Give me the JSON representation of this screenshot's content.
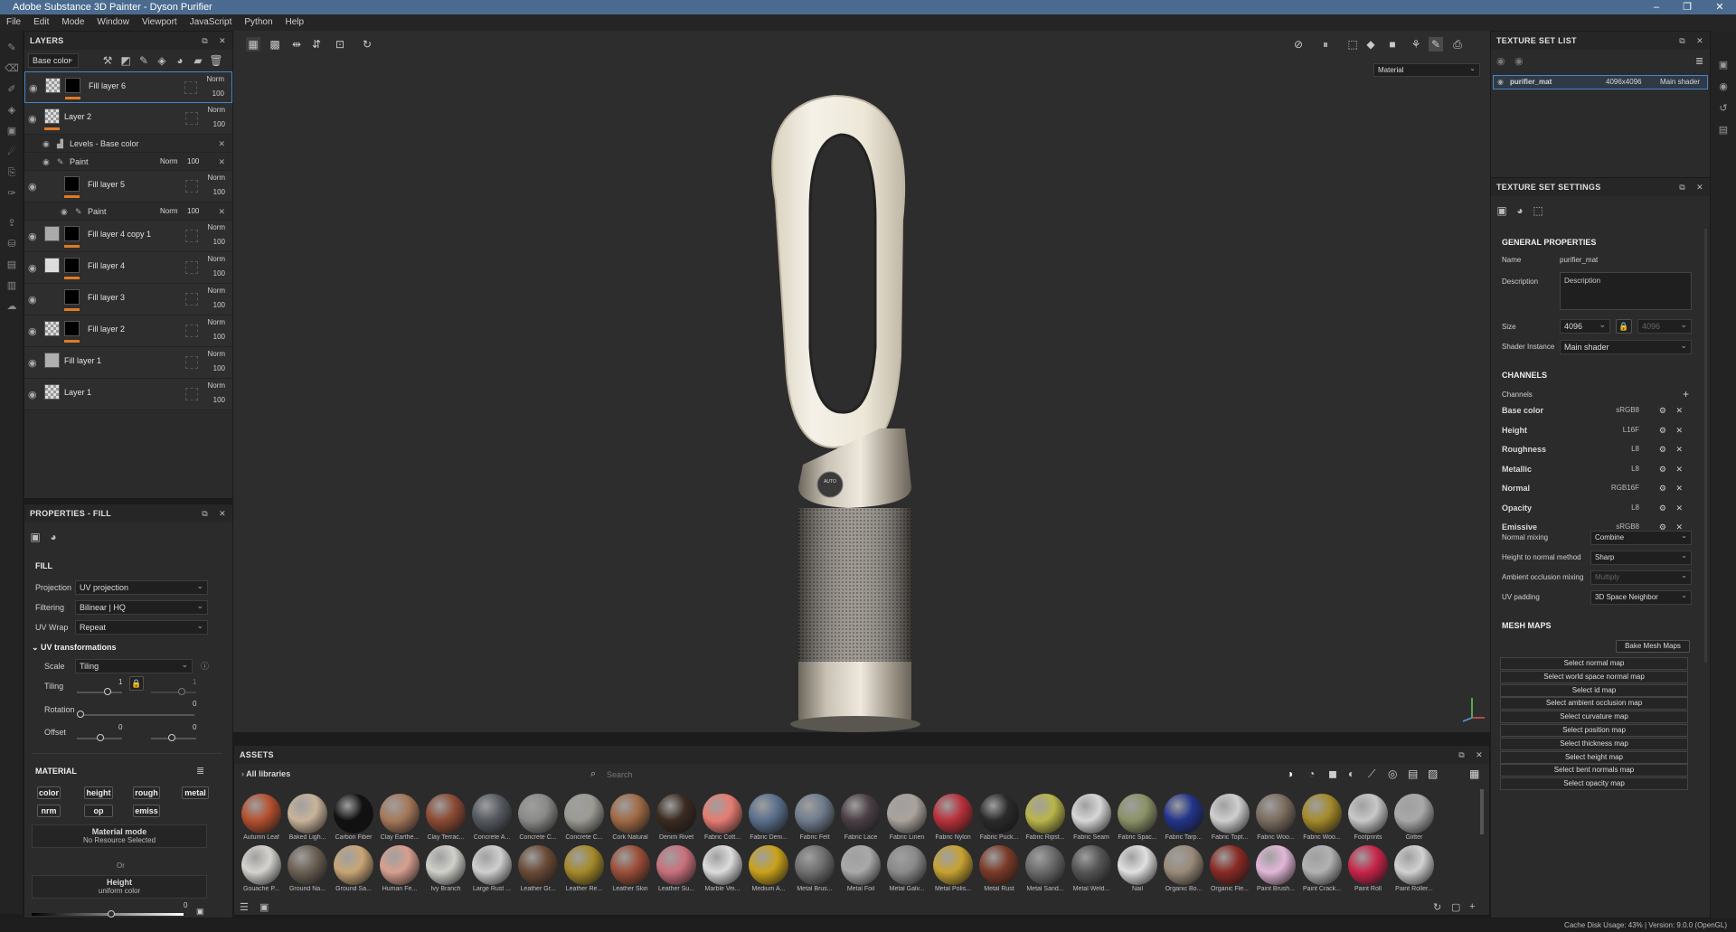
{
  "app": {
    "title": "Adobe Substance 3D Painter - Dyson Purifier"
  },
  "menu": [
    "File",
    "Edit",
    "Mode",
    "Window",
    "Viewport",
    "JavaScript",
    "Python",
    "Help"
  ],
  "layers": {
    "title": "LAYERS",
    "channel_select": "Base color",
    "items": [
      {
        "name": "Fill layer 6",
        "blend": "Norm",
        "opacity": "100",
        "thumb": "checker",
        "mask": "blk"
      },
      {
        "name": "Layer 2",
        "blend": "Norm",
        "opacity": "100",
        "thumb": "checker"
      },
      {
        "name": "Fill layer 5",
        "blend": "Norm",
        "opacity": "100",
        "thumb": "blk",
        "mask": "blk"
      },
      {
        "name": "Fill layer 4 copy 1",
        "blend": "Norm",
        "opacity": "100",
        "thumb": "gray",
        "mask": "blk"
      },
      {
        "name": "Fill layer 4",
        "blend": "Norm",
        "opacity": "100",
        "thumb": "gray",
        "mask": "blk"
      },
      {
        "name": "Fill layer 3",
        "blend": "Norm",
        "opacity": "100",
        "thumb": "blk",
        "mask": "blk"
      },
      {
        "name": "Fill layer 2",
        "blend": "Norm",
        "opacity": "100",
        "thumb": "checker",
        "mask": "blk"
      },
      {
        "name": "Fill layer 1",
        "blend": "Norm",
        "opacity": "100",
        "thumb": "gray"
      },
      {
        "name": "Layer 1",
        "blend": "Norm",
        "opacity": "100",
        "thumb": "checker"
      }
    ],
    "sub_levels": "Levels - Base color",
    "sub_paint": "Paint",
    "sub_paint_blend": "Norm",
    "sub_paint_opacity": "100"
  },
  "properties": {
    "title": "PROPERTIES - FILL",
    "fill_section": "FILL",
    "projection_label": "Projection",
    "projection": "UV projection",
    "filtering_label": "Filtering",
    "filtering": "Bilinear | HQ",
    "uvwrap_label": "UV Wrap",
    "uvwrap": "Repeat",
    "uvtrans": "UV transformations",
    "scale_label": "Scale",
    "scale": "Tiling",
    "tiling_label": "Tiling",
    "tiling_val": "1",
    "tiling_val2": "1",
    "rotation_label": "Rotation",
    "rotation_val": "0",
    "offset_label": "Offset",
    "offset_val1": "0",
    "offset_val2": "0",
    "material_section": "MATERIAL",
    "channel_buttons": [
      "color",
      "height",
      "rough",
      "metal",
      "nrm",
      "op",
      "emiss"
    ],
    "material_mode_title": "Material mode",
    "material_mode_value": "No Resource Selected",
    "or": "Or",
    "height_title": "Height",
    "height_value": "uniform color",
    "height_slider_val": "0"
  },
  "viewport": {
    "material_select": "Material",
    "badge": "AUTO"
  },
  "assets": {
    "title": "ASSETS",
    "libraries": "All libraries",
    "search_placeholder": "Search",
    "row1": [
      {
        "n": "Autumn Leaf",
        "c": "#b4502f"
      },
      {
        "n": "Baked Ligh...",
        "c": "#c9b49a"
      },
      {
        "n": "Carbon Fiber",
        "c": "#111"
      },
      {
        "n": "Clay Earthe...",
        "c": "#a5785a"
      },
      {
        "n": "Clay Terrac...",
        "c": "#8c4a33"
      },
      {
        "n": "Concrete A...",
        "c": "#555a60"
      },
      {
        "n": "Concrete C...",
        "c": "#8a8a88"
      },
      {
        "n": "Concrete C...",
        "c": "#9b9a93"
      },
      {
        "n": "Cork Natural",
        "c": "#a06a45"
      },
      {
        "n": "Denim Rivet",
        "c": "#3a2a20"
      },
      {
        "n": "Fabric Cott...",
        "c": "#e77c72"
      },
      {
        "n": "Fabric Deni...",
        "c": "#5a6f8c"
      },
      {
        "n": "Fabric Felt",
        "c": "#6f7c8c"
      },
      {
        "n": "Fabric Lace",
        "c": "#4a3f45"
      },
      {
        "n": "Fabric Linen",
        "c": "#aaa39c"
      },
      {
        "n": "Fabric Nylon",
        "c": "#b8303a"
      },
      {
        "n": "Fabric Puck...",
        "c": "#2a2a2a"
      },
      {
        "n": "Fabric Ripst...",
        "c": "#b9b54a"
      },
      {
        "n": "Fabric Seam",
        "c": "#d7d7d7"
      },
      {
        "n": "Fabric Spac...",
        "c": "#8b9266"
      },
      {
        "n": "Fabric Tarp...",
        "c": "#22348a"
      },
      {
        "n": "Fabric Topt...",
        "c": "#cfcfcf"
      },
      {
        "n": "Fabric Woo...",
        "c": "#7b6d5f"
      },
      {
        "n": "Fabric Woo...",
        "c": "#a58a2a"
      },
      {
        "n": "Footprints",
        "c": "#c8c8c8"
      },
      {
        "n": "Glitter",
        "c": "#a9a9a9"
      }
    ],
    "row2": [
      {
        "n": "Gouache P...",
        "c": "#d5d3cf"
      },
      {
        "n": "Ground Na...",
        "c": "#6a5f52"
      },
      {
        "n": "Ground Sa...",
        "c": "#c8a676"
      },
      {
        "n": "Human Fe...",
        "c": "#d79f8f"
      },
      {
        "n": "Ivy Branch",
        "c": "#cfd1c9"
      },
      {
        "n": "Large Rust ...",
        "c": "#cfcfcf"
      },
      {
        "n": "Leather Gr...",
        "c": "#6a4a36"
      },
      {
        "n": "Leather Re...",
        "c": "#a58a2a"
      },
      {
        "n": "Leather Skin",
        "c": "#9b4e38"
      },
      {
        "n": "Leather Su...",
        "c": "#c9707c"
      },
      {
        "n": "Marble Vei...",
        "c": "#dcdcdc"
      },
      {
        "n": "Medium A...",
        "c": "#c9a21a"
      },
      {
        "n": "Metal Brus...",
        "c": "#6f6f6f"
      },
      {
        "n": "Metal Foil",
        "c": "#a9a9a9"
      },
      {
        "n": "Metal Galv...",
        "c": "#8a8a8a"
      },
      {
        "n": "Metal Polis...",
        "c": "#c7a232"
      },
      {
        "n": "Metal Rust",
        "c": "#7a3a28"
      },
      {
        "n": "Metal Sand...",
        "c": "#6a6a6a"
      },
      {
        "n": "Metal Weld...",
        "c": "#555"
      },
      {
        "n": "Nail",
        "c": "#e0e0e0"
      },
      {
        "n": "Organic Bo...",
        "c": "#9a8b7a"
      },
      {
        "n": "Organic Fle...",
        "c": "#8a2a24"
      },
      {
        "n": "Paint Brush...",
        "c": "#e2b7d8"
      },
      {
        "n": "Paint Crack...",
        "c": "#b2b2b2"
      },
      {
        "n": "Paint Roll",
        "c": "#c8254a"
      },
      {
        "n": "Paint Roller...",
        "c": "#d1d1d1"
      }
    ]
  },
  "texture_set_list": {
    "title": "TEXTURE SET LIST",
    "item_name": "purifier_mat",
    "item_size": "4096x4096",
    "item_shader": "Main shader"
  },
  "tss": {
    "title": "TEXTURE SET SETTINGS",
    "general": "GENERAL PROPERTIES",
    "name_label": "Name",
    "name": "purifier_mat",
    "desc_label": "Description",
    "desc": "Description",
    "size_label": "Size",
    "size": "4096",
    "size2": "4096",
    "shader_label": "Shader Instance",
    "shader": "Main shader",
    "channels_section": "CHANNELS",
    "channels_label": "Channels",
    "channels": [
      {
        "name": "Base color",
        "fmt": "sRGB8"
      },
      {
        "name": "Height",
        "fmt": "L16F"
      },
      {
        "name": "Roughness",
        "fmt": "L8"
      },
      {
        "name": "Metallic",
        "fmt": "L8"
      },
      {
        "name": "Normal",
        "fmt": "RGB16F"
      },
      {
        "name": "Opacity",
        "fmt": "L8"
      },
      {
        "name": "Emissive",
        "fmt": "sRGB8"
      }
    ],
    "normal_mixing_label": "Normal mixing",
    "normal_mixing": "Combine",
    "h2n_label": "Height to normal method",
    "h2n": "Sharp",
    "ao_label": "Ambient occlusion mixing",
    "ao": "Multiply",
    "uvpad_label": "UV padding",
    "uvpad": "3D Space Neighbor",
    "mesh_maps": "MESH MAPS",
    "bake": "Bake Mesh Maps",
    "maps": [
      "Select normal map",
      "Select world space normal map",
      "Select id map",
      "Select ambient occlusion map",
      "Select curvature map",
      "Select position map",
      "Select thickness map",
      "Select height map",
      "Select bent normals map",
      "Select opacity map"
    ]
  },
  "status": {
    "text": "Cache Disk Usage:   43% | Version: 9.0.0 (OpenGL)"
  }
}
